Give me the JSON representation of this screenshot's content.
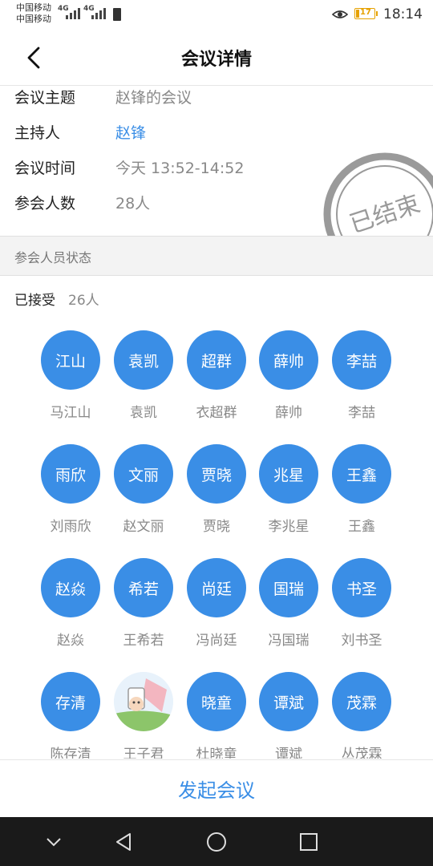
{
  "status_bar": {
    "carrier_1": "中国移动",
    "carrier_2": "中国移动",
    "network_1": "4G",
    "network_2": "4G",
    "battery": "17",
    "time": "18:14"
  },
  "header": {
    "title": "会议详情",
    "back_icon": "chevron-left-icon"
  },
  "meeting": {
    "subject_label": "会议主题",
    "subject_value": "赵锋的会议",
    "host_label": "主持人",
    "host_value": "赵锋",
    "time_label": "会议时间",
    "time_value": "今天 13:52-14:52",
    "count_label": "参会人数",
    "count_value": "28人",
    "stamp_text": "已结束"
  },
  "participants": {
    "section_title": "参会人员状态",
    "accepted_label": "已接受",
    "accepted_count": "26人",
    "members": [
      {
        "avatar": "江山",
        "name": "马江山"
      },
      {
        "avatar": "袁凯",
        "name": "袁凯"
      },
      {
        "avatar": "超群",
        "name": "衣超群"
      },
      {
        "avatar": "薛帅",
        "name": "薛帅"
      },
      {
        "avatar": "李喆",
        "name": "李喆"
      },
      {
        "avatar": "雨欣",
        "name": "刘雨欣"
      },
      {
        "avatar": "文丽",
        "name": "赵文丽"
      },
      {
        "avatar": "贾晓",
        "name": "贾晓"
      },
      {
        "avatar": "兆星",
        "name": "李兆星"
      },
      {
        "avatar": "王鑫",
        "name": "王鑫"
      },
      {
        "avatar": "赵焱",
        "name": "赵焱"
      },
      {
        "avatar": "希若",
        "name": "王希若"
      },
      {
        "avatar": "尚廷",
        "name": "冯尚廷"
      },
      {
        "avatar": "国瑞",
        "name": "冯国瑞"
      },
      {
        "avatar": "书圣",
        "name": "刘书圣"
      },
      {
        "avatar": "存清",
        "name": "陈存清"
      },
      {
        "avatar": "",
        "name": "王子君"
      },
      {
        "avatar": "晓童",
        "name": "杜晓童"
      },
      {
        "avatar": "谭斌",
        "name": "谭斌"
      },
      {
        "avatar": "茂霖",
        "name": "丛茂霖"
      }
    ]
  },
  "bottom": {
    "start_button": "发起会议"
  },
  "colors": {
    "accent": "#3a8ee6",
    "stamp": "#9a9a9a"
  }
}
